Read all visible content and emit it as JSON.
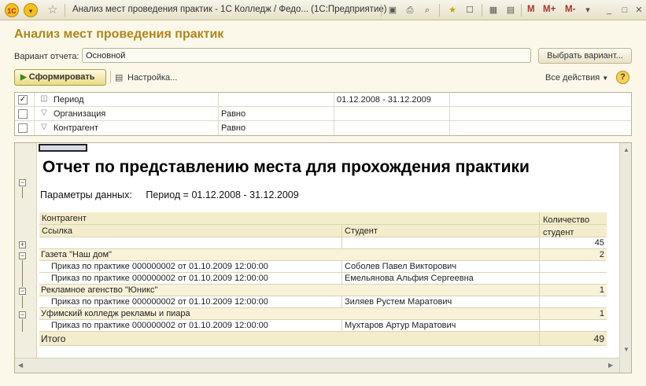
{
  "window": {
    "title": "Анализ мест проведения практик - 1С Колледж / Федо...   (1С:Предприятие)",
    "logo": "1C",
    "mem_buttons": [
      "M",
      "M+",
      "M-"
    ]
  },
  "form": {
    "title": "Анализ мест проведения практик",
    "variant_label": "Вариант отчета:",
    "variant_value": "Основной",
    "choose_variant": "Выбрать вариант...",
    "generate": "Сформировать",
    "settings": "Настройка...",
    "all_actions": "Все действия",
    "help": "?"
  },
  "settings": [
    {
      "checked": true,
      "label": "Период",
      "op": "",
      "value": "01.12.2008 - 31.12.2009"
    },
    {
      "checked": false,
      "label": "Организация",
      "op": "Равно",
      "value": ""
    },
    {
      "checked": false,
      "label": "Контрагент",
      "op": "Равно",
      "value": ""
    }
  ],
  "report": {
    "title": "Отчет по представлению места для прохождения практики",
    "params_label": "Параметры данных:",
    "params_value": "Период = 01.12.2008 - 31.12.2009",
    "headers": {
      "counterparty": "Контрагент",
      "link": "Ссылка",
      "student": "Студент",
      "count": "Количество студент"
    },
    "total_top": "45",
    "groups": [
      {
        "name": "Газета \"Наш дом\"",
        "count": "2",
        "rows": [
          {
            "link": "Приказ по практике 000000002 от 01.10.2009 12:00:00",
            "student": "Соболев Павел Викторович"
          },
          {
            "link": "Приказ по практике 000000002 от 01.10.2009 12:00:00",
            "student": "Емельянова Альфия Сергеевна"
          }
        ]
      },
      {
        "name": "Рекламное агенство \"Юникс\"",
        "count": "1",
        "rows": [
          {
            "link": "Приказ по практике 000000002 от 01.10.2009 12:00:00",
            "student": "Зиляев Рустем Маратович"
          }
        ]
      },
      {
        "name": "Уфимский колледж рекламы и пиара",
        "count": "1",
        "rows": [
          {
            "link": "Приказ по практике 000000002 от 01.10.2009 12:00:00",
            "student": "Мухтаров Артур Маратович"
          }
        ]
      }
    ],
    "total_label": "Итого",
    "total_value": "49"
  }
}
